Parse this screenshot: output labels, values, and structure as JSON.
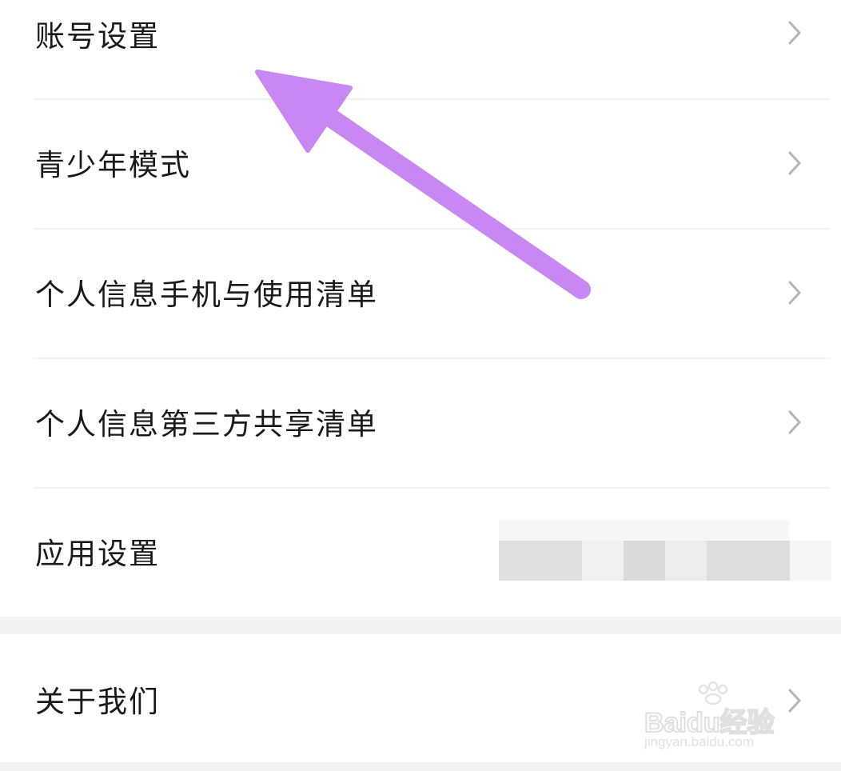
{
  "settings": {
    "items": [
      {
        "label": "账号设置"
      },
      {
        "label": "青少年模式"
      },
      {
        "label": "个人信息手机与使用清单"
      },
      {
        "label": "个人信息第三方共享清单"
      },
      {
        "label": "应用设置"
      }
    ],
    "about": {
      "label": "关于我们"
    }
  },
  "icons": {
    "chevron": "chevron-right-icon",
    "annotation": "arrow-icon"
  },
  "colors": {
    "background": "#ffffff",
    "text": "#1a1a1a",
    "chevron": "#b5b5b5",
    "divider": "#f2f2f2",
    "section_gap": "#f3f3f3",
    "annotation_arrow": "#c887f2"
  },
  "watermark": {
    "brand": "Bai",
    "brand2": "du",
    "brand3": "经验",
    "url": "jingyan.baidu.com"
  }
}
